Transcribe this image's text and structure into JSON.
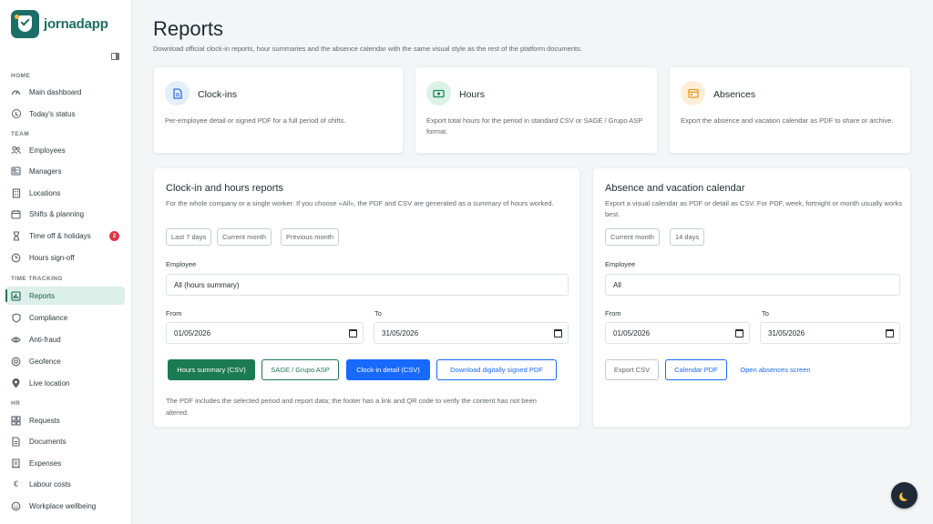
{
  "app": {
    "name": "jornadapp"
  },
  "colors": {
    "brand": "#1c6f66",
    "accent_green": "#1a7a51",
    "accent_blue": "#1769ff",
    "badge_red": "#dc3545"
  },
  "sidebar": {
    "sections": {
      "home": "HOME",
      "team": "TEAM",
      "time_tracking": "TIME TRACKING",
      "hr": "HR"
    },
    "items": [
      {
        "label": "Main dashboard",
        "icon": "dashboard-icon"
      },
      {
        "label": "Today's status",
        "icon": "clock-icon"
      },
      {
        "label": "Employees",
        "icon": "users-icon"
      },
      {
        "label": "Managers",
        "icon": "managers-icon"
      },
      {
        "label": "Locations",
        "icon": "building-icon"
      },
      {
        "label": "Shifts & planning",
        "icon": "calendar-icon"
      },
      {
        "label": "Time off & holidays",
        "icon": "hourglass-icon",
        "badge": "2"
      },
      {
        "label": "Hours sign-off",
        "icon": "hours-signoff-icon"
      },
      {
        "label": "Reports",
        "icon": "chart-icon",
        "active": true
      },
      {
        "label": "Compliance",
        "icon": "shield-icon"
      },
      {
        "label": "Anti-fraud",
        "icon": "eye-icon"
      },
      {
        "label": "Geofence",
        "icon": "globe-icon"
      },
      {
        "label": "Live location",
        "icon": "location-pin-icon"
      },
      {
        "label": "Requests",
        "icon": "requests-icon"
      },
      {
        "label": "Documents",
        "icon": "document-icon"
      },
      {
        "label": "Expenses",
        "icon": "receipt-icon"
      },
      {
        "label": "Labour costs",
        "icon": "euro-icon"
      },
      {
        "label": "Workplace wellbeing",
        "icon": "smile-icon"
      }
    ]
  },
  "page": {
    "title": "Reports",
    "subtitle": "Download official clock-in reports, hour summaries and the absence calendar with the same visual style as the rest of the platform documents."
  },
  "summary_cards": [
    {
      "title": "Clock-ins",
      "description": "Per-employee detail or signed PDF for a full period of shifts.",
      "icon": "document-icon",
      "icon_bg": "#e3efff",
      "icon_color": "#2f6fe0"
    },
    {
      "title": "Hours",
      "description": "Export total hours for the period in standard CSV or SAGE / Grupo ASP format.",
      "icon": "money-icon",
      "icon_bg": "#dcf2e8",
      "icon_color": "#1a8a5e"
    },
    {
      "title": "Absences",
      "description": "Export the absence and vacation calendar as PDF to share or archive.",
      "icon": "calendar-icon",
      "icon_bg": "#fdeed8",
      "icon_color": "#e69a1f"
    }
  ],
  "clockin_panel": {
    "title": "Clock-in and hours reports",
    "description": "For the whole company or a single worker. If you choose «All», the PDF and CSV are generated as a summary of hours worked.",
    "chips": [
      "Last 7 days",
      "Current month",
      "Previous month"
    ],
    "employee_label": "Employee",
    "employee_value": "All (hours summary)",
    "from_label": "From",
    "from_value": "01/05/2026",
    "to_label": "To",
    "to_value": "31/05/2026",
    "buttons": {
      "hours_summary": "Hours summary (CSV)",
      "sage": "SAGE / Grupo ASP",
      "clockin_detail": "Clock-in detail (CSV)",
      "signed_pdf": "Download digitally signed PDF"
    },
    "note": "The PDF includes the selected period and report data; the footer has a link and QR code to verify the content has not been altered."
  },
  "absence_panel": {
    "title": "Absence and vacation calendar",
    "description": "Export a visual calendar as PDF or detail as CSV. For PDF, week, fortnight or month usually works best.",
    "chips": [
      "Current month",
      "14 days"
    ],
    "employee_label": "Employee",
    "employee_value": "All",
    "from_label": "From",
    "from_value": "01/05/2026",
    "to_label": "To",
    "to_value": "31/05/2026",
    "buttons": {
      "export_csv": "Export CSV",
      "calendar_pdf": "Calendar PDF",
      "open_absences": "Open absences screen"
    }
  }
}
